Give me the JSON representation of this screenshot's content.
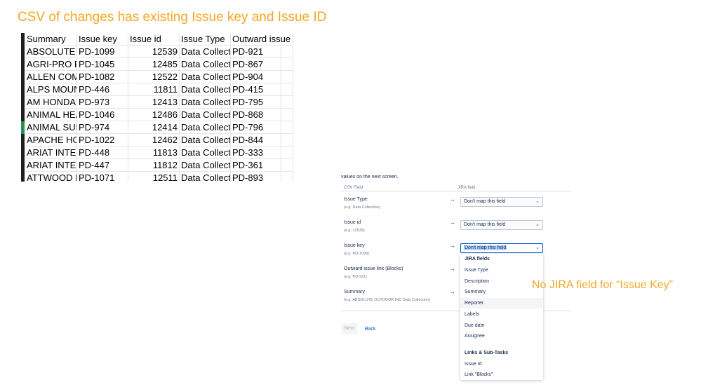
{
  "page_title": "CSV of changes has existing Issue key and Issue ID",
  "spreadsheet": {
    "headers": [
      "Summary",
      "Issue key",
      "Issue id",
      "Issue Type",
      "Outward issue li"
    ],
    "rows": [
      [
        "ABSOLUTE C",
        "PD-1099",
        "12539",
        "Data Collecti",
        "PD-921"
      ],
      [
        "AGRI-PRO EI",
        "PD-1045",
        "12485",
        "Data Collecti",
        "PD-867"
      ],
      [
        "ALLEN COMF",
        "PD-1082",
        "12522",
        "Data Collecti",
        "PD-904"
      ],
      [
        "ALPS MOUNT",
        "PD-446",
        "11811",
        "Data Collecti",
        "PD-415"
      ],
      [
        "AM HONDA I",
        "PD-973",
        "12413",
        "Data Collecti",
        "PD-795"
      ],
      [
        "ANIMAL HEA",
        "PD-1046",
        "12486",
        "Data Collecti",
        "PD-868"
      ],
      [
        "ANIMAL SUP",
        "PD-974",
        "12414",
        "Data Collecti",
        "PD-796"
      ],
      [
        "APACHE HOS",
        "PD-1022",
        "12462",
        "Data Collecti",
        "PD-844"
      ],
      [
        "ARIAT INTER",
        "PD-448",
        "11813",
        "Data Collecti",
        "PD-333"
      ],
      [
        "ARIAT INTER",
        "PD-447",
        "11812",
        "Data Collecti",
        "PD-361"
      ],
      [
        "ATTWOOD N",
        "PD-1071",
        "12511",
        "Data Collecti",
        "PD-893"
      ]
    ]
  },
  "jira_panel": {
    "hint": "values on the next screen.",
    "col_csv": "CSV Field",
    "col_jira": "JIRA field",
    "arrow": "→",
    "rows": [
      {
        "label": "Issue Type",
        "example": "(e.g. Data Collection)",
        "value": "Don't map this field"
      },
      {
        "label": "Issue id",
        "example": "(e.g. 12539)",
        "value": "Don't map this field"
      },
      {
        "label": "Issue key",
        "example": "(e.g. PD-1099)",
        "value": "Don't map this field"
      },
      {
        "label": "Outward issue link (Blocks)",
        "example": "(e.g. PD-921)"
      },
      {
        "label": "Summary",
        "example": "(e.g. ABSOLUTE OUTDOOR INC Data Collection)"
      }
    ],
    "next_label": "Next",
    "back_label": "Back",
    "dropdown": {
      "group1": "JIRA fields",
      "items1": [
        "Issue Type",
        "Description",
        "Summary",
        "Reporter",
        "Labels",
        "Due date",
        "Assignee"
      ],
      "group2": "Links & Sub-Tasks",
      "items2": [
        "Issue Id",
        "Link \"Blocks\""
      ]
    }
  },
  "annotation": "No JIRA field for “Issue Key”",
  "colors": {
    "annotation": "#f5a623",
    "link": "#0052cc"
  }
}
